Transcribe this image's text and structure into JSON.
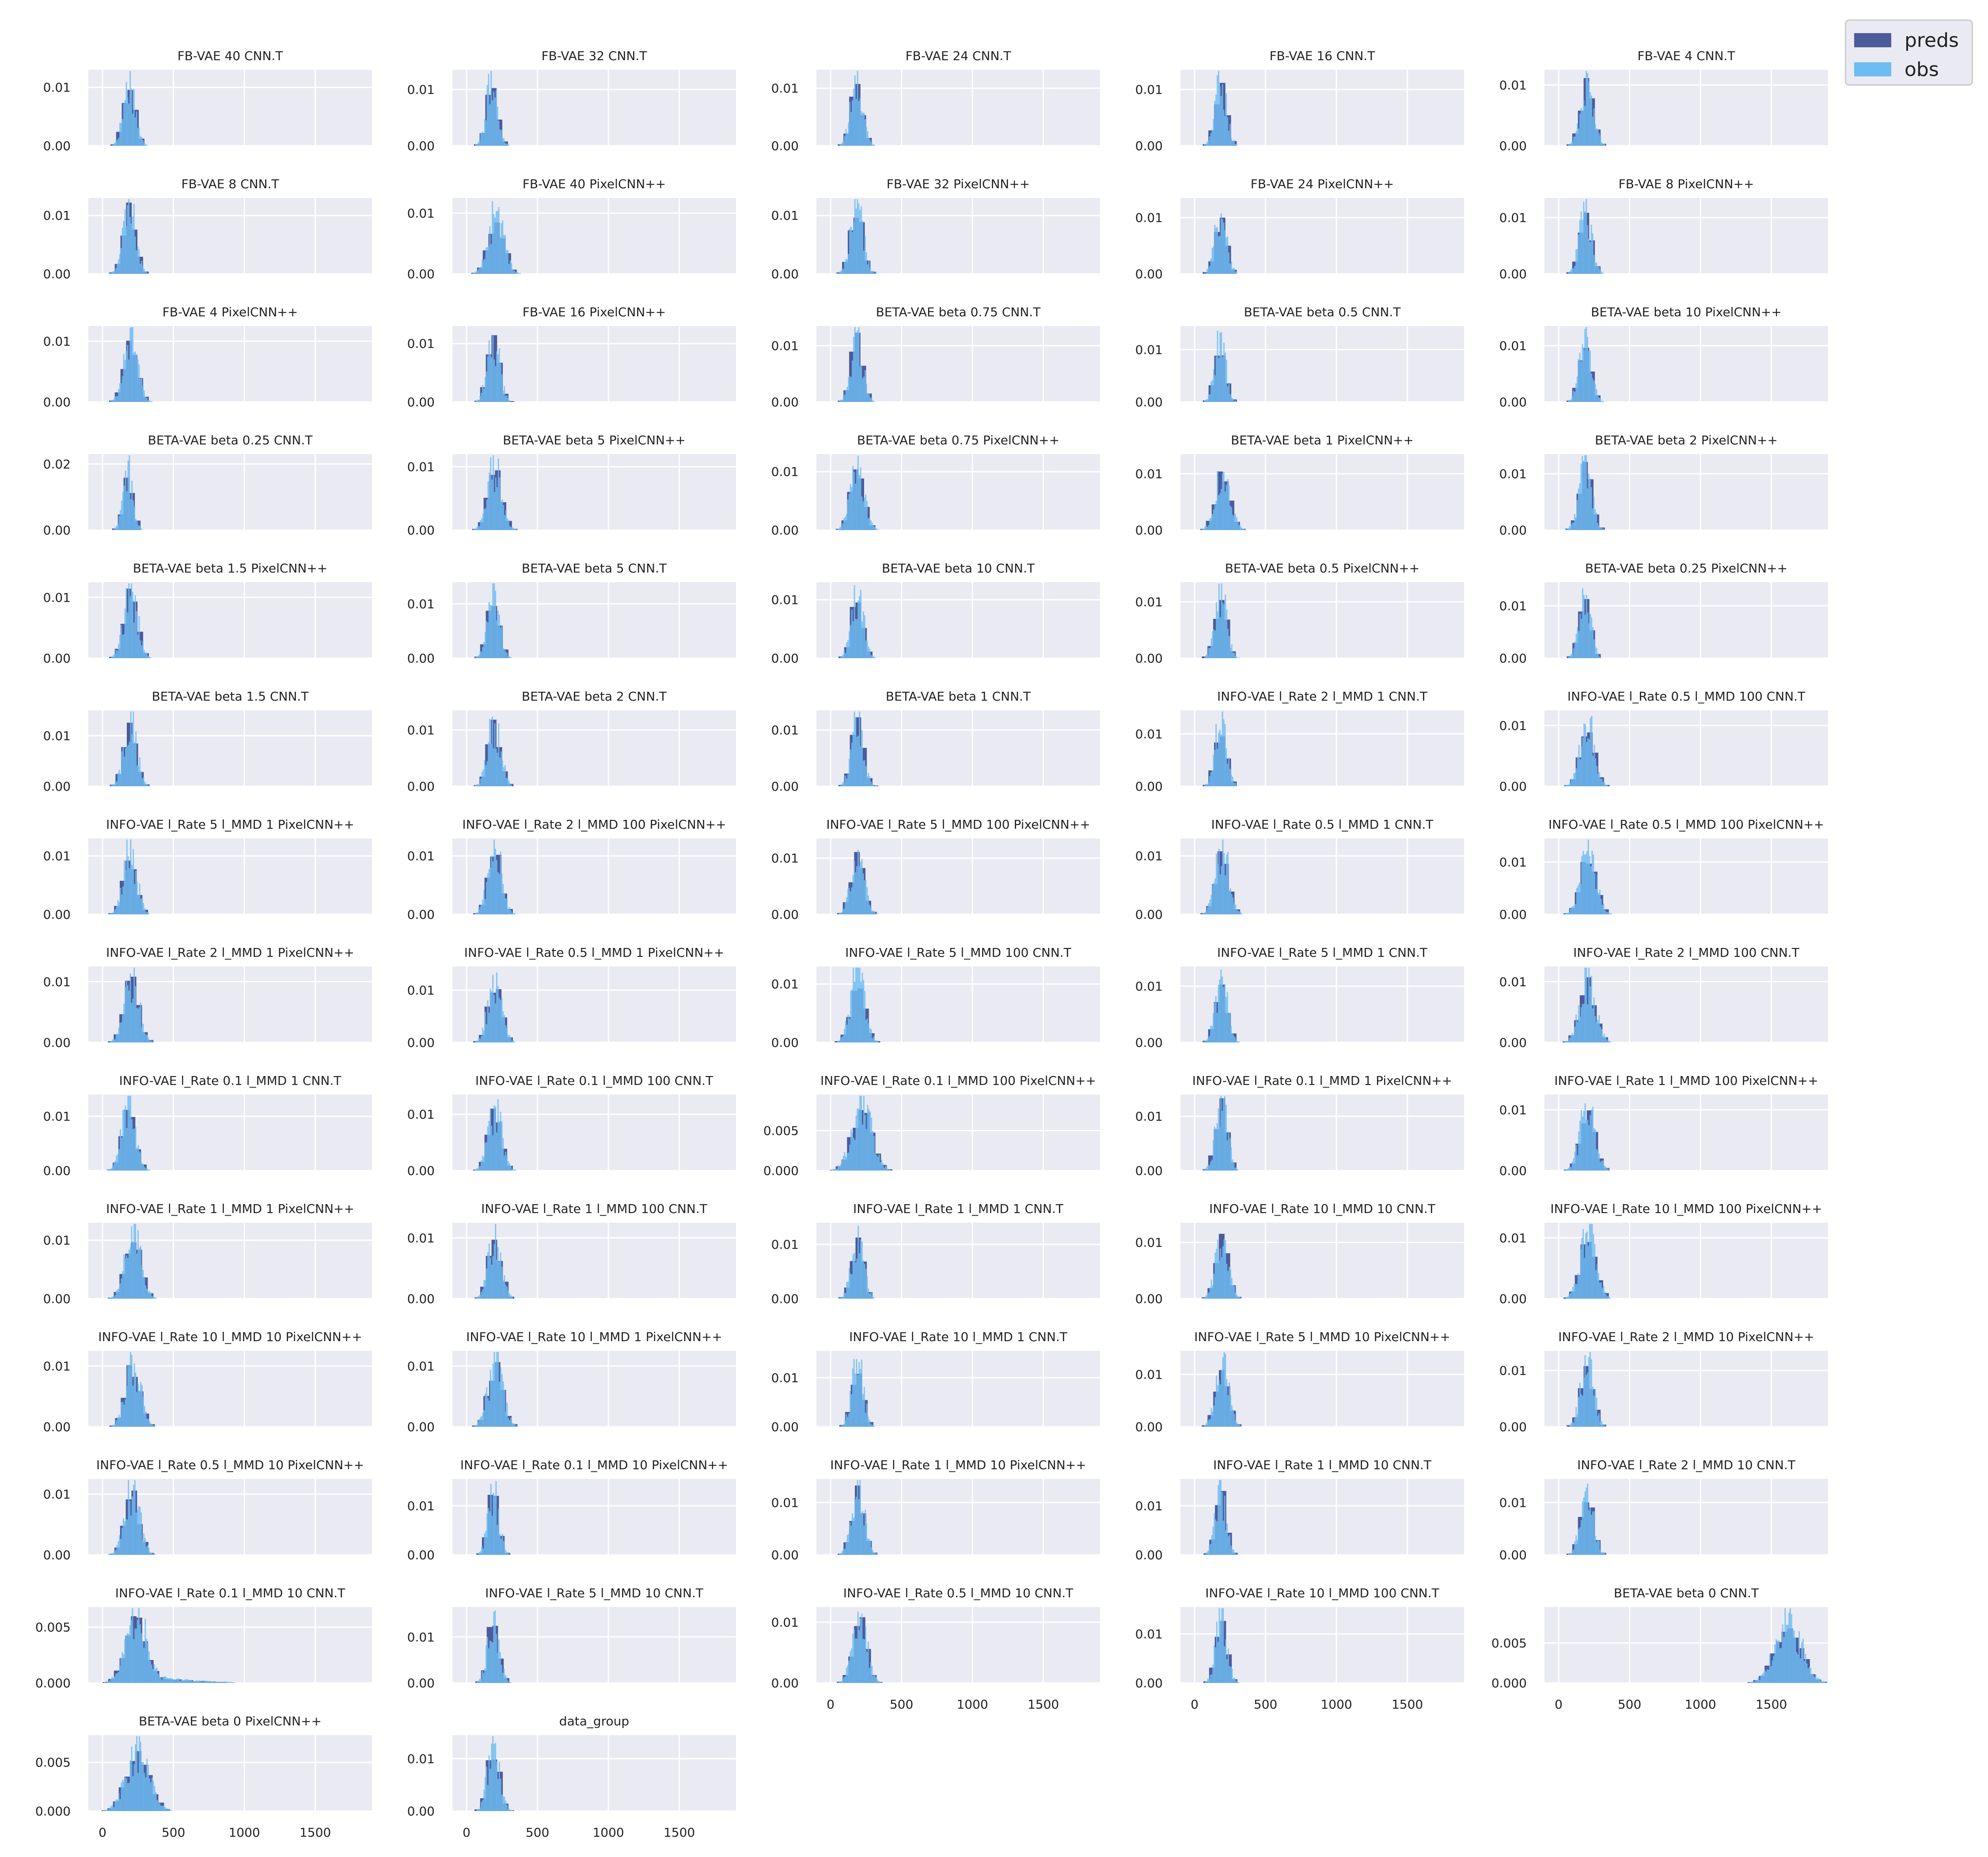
{
  "colors": {
    "preds": "#4c5b9b",
    "obs": "#6ebcf2",
    "overlap": "#4fa1de",
    "panel_bg": "#eaeaf2",
    "grid": "#ffffff",
    "text": "#222222"
  },
  "legend": {
    "placement": "top-right",
    "items": [
      {
        "label": "preds",
        "color": "#4c5b9b"
      },
      {
        "label": "obs",
        "color": "#6ebcf2"
      }
    ]
  },
  "chart_data": {
    "type": "histogram_grid",
    "xlim": [
      -100,
      1900
    ],
    "x_ticks": [
      0,
      500,
      1000,
      1500
    ],
    "x_tick_labels": [
      "0",
      "500",
      "1000",
      "1500"
    ],
    "grid": true,
    "series_names": [
      "preds",
      "obs"
    ],
    "panels": [
      {
        "title": "FB-VAE 40 CNN.T",
        "yticks": [
          0,
          0.01
        ],
        "ytick_labels": [
          "0.00",
          "0.01"
        ],
        "ymax": 0.013,
        "mean": 190,
        "sd": 42,
        "peak": 0.0115
      },
      {
        "title": "FB-VAE 32 CNN.T",
        "yticks": [
          0,
          0.01
        ],
        "ytick_labels": [
          "0.00",
          "0.01"
        ],
        "ymax": 0.0135,
        "mean": 180,
        "sd": 40,
        "peak": 0.0122
      },
      {
        "title": "FB-VAE 24 CNN.T",
        "yticks": [
          0,
          0.01
        ],
        "ytick_labels": [
          "0.00",
          "0.01"
        ],
        "ymax": 0.0132,
        "mean": 185,
        "sd": 42,
        "peak": 0.0118
      },
      {
        "title": "FB-VAE 16 CNN.T",
        "yticks": [
          0,
          0.01
        ],
        "ytick_labels": [
          "0.00",
          "0.01"
        ],
        "ymax": 0.0135,
        "mean": 185,
        "sd": 40,
        "peak": 0.0122
      },
      {
        "title": "FB-VAE 4 CNN.T",
        "yticks": [
          0,
          0.01
        ],
        "ytick_labels": [
          "0.00",
          "0.01"
        ],
        "ymax": 0.0125,
        "mean": 200,
        "sd": 45,
        "peak": 0.0112
      },
      {
        "title": "FB-VAE 8 CNN.T",
        "yticks": [
          0,
          0.01
        ],
        "ytick_labels": [
          "0.00",
          "0.01"
        ],
        "ymax": 0.013,
        "mean": 190,
        "sd": 45,
        "peak": 0.0118
      },
      {
        "title": "FB-VAE 40 PixelCNN++",
        "yticks": [
          0,
          0.01
        ],
        "ytick_labels": [
          "0.00",
          "0.01"
        ],
        "ymax": 0.0125,
        "mean": 210,
        "sd": 55,
        "peak": 0.0105
      },
      {
        "title": "FB-VAE 32 PixelCNN++",
        "yticks": [
          0,
          0.01
        ],
        "ytick_labels": [
          "0.00",
          "0.01"
        ],
        "ymax": 0.013,
        "mean": 185,
        "sd": 45,
        "peak": 0.0118
      },
      {
        "title": "FB-VAE 24 PixelCNN++",
        "yticks": [
          0,
          0.01
        ],
        "ytick_labels": [
          "0.00",
          "0.01"
        ],
        "ymax": 0.0135,
        "mean": 185,
        "sd": 40,
        "peak": 0.0122
      },
      {
        "title": "FB-VAE 8 PixelCNN++",
        "yticks": [
          0,
          0.01
        ],
        "ytick_labels": [
          "0.00",
          "0.01"
        ],
        "ymax": 0.0135,
        "mean": 190,
        "sd": 42,
        "peak": 0.0122
      },
      {
        "title": "FB-VAE 4 PixelCNN++",
        "yticks": [
          0,
          0.01
        ],
        "ytick_labels": [
          "0.00",
          "0.01"
        ],
        "ymax": 0.0125,
        "mean": 200,
        "sd": 48,
        "peak": 0.0112
      },
      {
        "title": "FB-VAE 16 PixelCNN++",
        "yticks": [
          0,
          0.01
        ],
        "ytick_labels": [
          "0.00",
          "0.01"
        ],
        "ymax": 0.013,
        "mean": 190,
        "sd": 42,
        "peak": 0.0118
      },
      {
        "title": "BETA-VAE beta 0.75 CNN.T",
        "yticks": [
          0,
          0.01
        ],
        "ytick_labels": [
          "0.00",
          "0.01"
        ],
        "ymax": 0.0135,
        "mean": 185,
        "sd": 42,
        "peak": 0.0122
      },
      {
        "title": "BETA-VAE beta 0.5 CNN.T",
        "yticks": [
          0,
          0.01
        ],
        "ytick_labels": [
          "0.00",
          "0.01"
        ],
        "ymax": 0.0145,
        "mean": 180,
        "sd": 38,
        "peak": 0.0132
      },
      {
        "title": "BETA-VAE beta 10 PixelCNN++",
        "yticks": [
          0,
          0.01
        ],
        "ytick_labels": [
          "0.00",
          "0.01"
        ],
        "ymax": 0.0135,
        "mean": 190,
        "sd": 42,
        "peak": 0.0122
      },
      {
        "title": "BETA-VAE beta 0.25 CNN.T",
        "yticks": [
          0,
          0.02
        ],
        "ytick_labels": [
          "0.00",
          "0.02"
        ],
        "ymax": 0.023,
        "mean": 180,
        "sd": 35,
        "peak": 0.0185
      },
      {
        "title": "BETA-VAE beta 5 PixelCNN++",
        "yticks": [
          0,
          0.01
        ],
        "ytick_labels": [
          "0.00",
          "0.01"
        ],
        "ymax": 0.012,
        "mean": 200,
        "sd": 50,
        "peak": 0.0108
      },
      {
        "title": "BETA-VAE beta 0.75 PixelCNN++",
        "yticks": [
          0,
          0.01
        ],
        "ytick_labels": [
          "0.00",
          "0.01"
        ],
        "ymax": 0.013,
        "mean": 190,
        "sd": 48,
        "peak": 0.0118
      },
      {
        "title": "BETA-VAE beta 1 PixelCNN++",
        "yticks": [
          0,
          0.01
        ],
        "ytick_labels": [
          "0.00",
          "0.01"
        ],
        "ymax": 0.0135,
        "mean": 200,
        "sd": 50,
        "peak": 0.0118
      },
      {
        "title": "BETA-VAE beta 2 PixelCNN++",
        "yticks": [
          0,
          0.01
        ],
        "ytick_labels": [
          "0.00",
          "0.01"
        ],
        "ymax": 0.0135,
        "mean": 190,
        "sd": 45,
        "peak": 0.0122
      },
      {
        "title": "BETA-VAE beta 1.5 PixelCNN++",
        "yticks": [
          0,
          0.01
        ],
        "ytick_labels": [
          "0.00",
          "0.01"
        ],
        "ymax": 0.0125,
        "mean": 200,
        "sd": 48,
        "peak": 0.0115
      },
      {
        "title": "BETA-VAE beta 5 CNN.T",
        "yticks": [
          0,
          0.01
        ],
        "ytick_labels": [
          "0.00",
          "0.01"
        ],
        "ymax": 0.014,
        "mean": 190,
        "sd": 42,
        "peak": 0.0125
      },
      {
        "title": "BETA-VAE beta 10 CNN.T",
        "yticks": [
          0,
          0.01
        ],
        "ytick_labels": [
          "0.00",
          "0.01"
        ],
        "ymax": 0.013,
        "mean": 190,
        "sd": 42,
        "peak": 0.0118
      },
      {
        "title": "BETA-VAE beta 0.5 PixelCNN++",
        "yticks": [
          0,
          0.01
        ],
        "ytick_labels": [
          "0.00",
          "0.01"
        ],
        "ymax": 0.0135,
        "mean": 185,
        "sd": 42,
        "peak": 0.0122
      },
      {
        "title": "BETA-VAE beta 0.25 PixelCNN++",
        "yticks": [
          0,
          0.01
        ],
        "ytick_labels": [
          "0.00",
          "0.01"
        ],
        "ymax": 0.0145,
        "mean": 185,
        "sd": 40,
        "peak": 0.0132
      },
      {
        "title": "BETA-VAE beta 1.5 CNN.T",
        "yticks": [
          0,
          0.01
        ],
        "ytick_labels": [
          "0.00",
          "0.01"
        ],
        "ymax": 0.015,
        "mean": 195,
        "sd": 45,
        "peak": 0.0135
      },
      {
        "title": "BETA-VAE beta 2 CNN.T",
        "yticks": [
          0,
          0.01
        ],
        "ytick_labels": [
          "0.00",
          "0.01"
        ],
        "ymax": 0.0135,
        "mean": 195,
        "sd": 45,
        "peak": 0.0122
      },
      {
        "title": "BETA-VAE beta 1 CNN.T",
        "yticks": [
          0,
          0.01
        ],
        "ytick_labels": [
          "0.00",
          "0.01"
        ],
        "ymax": 0.0135,
        "mean": 190,
        "sd": 42,
        "peak": 0.0122
      },
      {
        "title": "INFO-VAE l_Rate 2 l_MMD 1 CNN.T",
        "yticks": [
          0,
          0.01
        ],
        "ytick_labels": [
          "0.00",
          "0.01"
        ],
        "ymax": 0.0145,
        "mean": 185,
        "sd": 40,
        "peak": 0.0132
      },
      {
        "title": "INFO-VAE l_Rate 0.5 l_MMD 100 CNN.T",
        "yticks": [
          0,
          0.01
        ],
        "ytick_labels": [
          "0.00",
          "0.01"
        ],
        "ymax": 0.0125,
        "mean": 200,
        "sd": 50,
        "peak": 0.0112
      },
      {
        "title": "INFO-VAE l_Rate 5 l_MMD 1 PixelCNN++",
        "yticks": [
          0,
          0.01
        ],
        "ytick_labels": [
          "0.00",
          "0.01"
        ],
        "ymax": 0.013,
        "mean": 195,
        "sd": 48,
        "peak": 0.0115
      },
      {
        "title": "INFO-VAE l_Rate 2 l_MMD 100 PixelCNN++",
        "yticks": [
          0,
          0.01
        ],
        "ytick_labels": [
          "0.00",
          "0.01"
        ],
        "ymax": 0.013,
        "mean": 200,
        "sd": 48,
        "peak": 0.0118
      },
      {
        "title": "INFO-VAE l_Rate 5 l_MMD 100 PixelCNN++",
        "yticks": [
          0,
          0.01
        ],
        "ytick_labels": [
          "0.00",
          "0.01"
        ],
        "ymax": 0.0135,
        "mean": 190,
        "sd": 45,
        "peak": 0.0122
      },
      {
        "title": "INFO-VAE l_Rate 0.5 l_MMD 1 CNN.T",
        "yticks": [
          0,
          0.01
        ],
        "ytick_labels": [
          "0.00",
          "0.01"
        ],
        "ymax": 0.013,
        "mean": 195,
        "sd": 48,
        "peak": 0.0118
      },
      {
        "title": "INFO-VAE l_Rate 0.5 l_MMD 100 PixelCNN++",
        "yticks": [
          0,
          0.01
        ],
        "ytick_labels": [
          "0.00",
          "0.01"
        ],
        "ymax": 0.0145,
        "mean": 210,
        "sd": 55,
        "peak": 0.0125
      },
      {
        "title": "INFO-VAE l_Rate 2 l_MMD 1 PixelCNN++",
        "yticks": [
          0,
          0.01
        ],
        "ytick_labels": [
          "0.00",
          "0.01"
        ],
        "ymax": 0.0125,
        "mean": 205,
        "sd": 52,
        "peak": 0.0112
      },
      {
        "title": "INFO-VAE l_Rate 0.5 l_MMD 1 PixelCNN++",
        "yticks": [
          0,
          0.01
        ],
        "ytick_labels": [
          "0.00",
          "0.01"
        ],
        "ymax": 0.0145,
        "mean": 200,
        "sd": 48,
        "peak": 0.0128
      },
      {
        "title": "INFO-VAE l_Rate 5 l_MMD 100 CNN.T",
        "yticks": [
          0,
          0.01
        ],
        "ytick_labels": [
          "0.00",
          "0.01"
        ],
        "ymax": 0.013,
        "mean": 190,
        "sd": 50,
        "peak": 0.0118
      },
      {
        "title": "INFO-VAE l_Rate 5 l_MMD 1 CNN.T",
        "yticks": [
          0,
          0.01
        ],
        "ytick_labels": [
          "0.00",
          "0.01"
        ],
        "ymax": 0.0135,
        "mean": 190,
        "sd": 42,
        "peak": 0.0122
      },
      {
        "title": "INFO-VAE l_Rate 2 l_MMD 100 CNN.T",
        "yticks": [
          0,
          0.01
        ],
        "ytick_labels": [
          "0.00",
          "0.01"
        ],
        "ymax": 0.0125,
        "mean": 205,
        "sd": 55,
        "peak": 0.0108
      },
      {
        "title": "INFO-VAE l_Rate 0.1 l_MMD 1 CNN.T",
        "yticks": [
          0,
          0.01
        ],
        "ytick_labels": [
          "0.00",
          "0.01"
        ],
        "ymax": 0.014,
        "mean": 185,
        "sd": 48,
        "peak": 0.0125
      },
      {
        "title": "INFO-VAE l_Rate 0.1 l_MMD 100 CNN.T",
        "yticks": [
          0,
          0.01
        ],
        "ytick_labels": [
          "0.00",
          "0.01"
        ],
        "ymax": 0.0135,
        "mean": 200,
        "sd": 48,
        "peak": 0.0118
      },
      {
        "title": "INFO-VAE l_Rate 0.1 l_MMD 100 PixelCNN++",
        "yticks": [
          0,
          0.005
        ],
        "ytick_labels": [
          "0.000",
          "0.005"
        ],
        "ymax": 0.0095,
        "mean": 220,
        "sd": 70,
        "peak": 0.0085
      },
      {
        "title": "INFO-VAE l_Rate 0.1 l_MMD 1 PixelCNN++",
        "yticks": [
          0,
          0.01
        ],
        "ytick_labels": [
          "0.00",
          "0.01"
        ],
        "ymax": 0.014,
        "mean": 190,
        "sd": 42,
        "peak": 0.0128
      },
      {
        "title": "INFO-VAE l_Rate 1 l_MMD 100 PixelCNN++",
        "yticks": [
          0,
          0.01
        ],
        "ytick_labels": [
          "0.00",
          "0.01"
        ],
        "ymax": 0.0125,
        "mean": 205,
        "sd": 52,
        "peak": 0.0112
      },
      {
        "title": "INFO-VAE l_Rate 1 l_MMD 1 PixelCNN++",
        "yticks": [
          0,
          0.01
        ],
        "ytick_labels": [
          "0.00",
          "0.01"
        ],
        "ymax": 0.013,
        "mean": 215,
        "sd": 55,
        "peak": 0.0115
      },
      {
        "title": "INFO-VAE l_Rate 1 l_MMD 100 CNN.T",
        "yticks": [
          0,
          0.01
        ],
        "ytick_labels": [
          "0.00",
          "0.01"
        ],
        "ymax": 0.0125,
        "mean": 200,
        "sd": 45,
        "peak": 0.0112
      },
      {
        "title": "INFO-VAE l_Rate 1 l_MMD 1 CNN.T",
        "yticks": [
          0,
          0.01
        ],
        "ytick_labels": [
          "0.00",
          "0.01"
        ],
        "ymax": 0.014,
        "mean": 190,
        "sd": 42,
        "peak": 0.0125
      },
      {
        "title": "INFO-VAE l_Rate 10 l_MMD 10 CNN.T",
        "yticks": [
          0,
          0.01
        ],
        "ytick_labels": [
          "0.00",
          "0.01"
        ],
        "ymax": 0.0135,
        "mean": 195,
        "sd": 45,
        "peak": 0.0122
      },
      {
        "title": "INFO-VAE l_Rate 10 l_MMD 100 PixelCNN++",
        "yticks": [
          0,
          0.01
        ],
        "ytick_labels": [
          "0.00",
          "0.01"
        ],
        "ymax": 0.0125,
        "mean": 210,
        "sd": 55,
        "peak": 0.0112
      },
      {
        "title": "INFO-VAE l_Rate 10 l_MMD 10 PixelCNN++",
        "yticks": [
          0,
          0.01
        ],
        "ytick_labels": [
          "0.00",
          "0.01"
        ],
        "ymax": 0.0125,
        "mean": 215,
        "sd": 52,
        "peak": 0.0112
      },
      {
        "title": "INFO-VAE l_Rate 10 l_MMD 1 PixelCNN++",
        "yticks": [
          0,
          0.01
        ],
        "ytick_labels": [
          "0.00",
          "0.01"
        ],
        "ymax": 0.0125,
        "mean": 205,
        "sd": 52,
        "peak": 0.0112
      },
      {
        "title": "INFO-VAE l_Rate 10 l_MMD 1 CNN.T",
        "yticks": [
          0,
          0.01
        ],
        "ytick_labels": [
          "0.00",
          "0.01"
        ],
        "ymax": 0.0155,
        "mean": 190,
        "sd": 40,
        "peak": 0.014
      },
      {
        "title": "INFO-VAE l_Rate 5 l_MMD 10 PixelCNN++",
        "yticks": [
          0,
          0.01
        ],
        "ytick_labels": [
          "0.00",
          "0.01"
        ],
        "ymax": 0.0145,
        "mean": 195,
        "sd": 45,
        "peak": 0.0128
      },
      {
        "title": "INFO-VAE l_Rate 2 l_MMD 10 PixelCNN++",
        "yticks": [
          0,
          0.01
        ],
        "ytick_labels": [
          "0.00",
          "0.01"
        ],
        "ymax": 0.0135,
        "mean": 200,
        "sd": 45,
        "peak": 0.0122
      },
      {
        "title": "INFO-VAE l_Rate 0.5 l_MMD 10 PixelCNN++",
        "yticks": [
          0,
          0.01
        ],
        "ytick_labels": [
          "0.00",
          "0.01"
        ],
        "ymax": 0.0125,
        "mean": 210,
        "sd": 52,
        "peak": 0.0112
      },
      {
        "title": "INFO-VAE l_Rate 0.1 l_MMD 10 PixelCNN++",
        "yticks": [
          0,
          0.01
        ],
        "ytick_labels": [
          "0.00",
          "0.01"
        ],
        "ymax": 0.0155,
        "mean": 190,
        "sd": 38,
        "peak": 0.014
      },
      {
        "title": "INFO-VAE l_Rate 1 l_MMD 10 PixelCNN++",
        "yticks": [
          0,
          0.01
        ],
        "ytick_labels": [
          "0.00",
          "0.01"
        ],
        "ymax": 0.0145,
        "mean": 195,
        "sd": 45,
        "peak": 0.0132
      },
      {
        "title": "INFO-VAE l_Rate 1 l_MMD 10 CNN.T",
        "yticks": [
          0,
          0.01
        ],
        "ytick_labels": [
          "0.00",
          "0.01"
        ],
        "ymax": 0.0155,
        "mean": 185,
        "sd": 38,
        "peak": 0.014
      },
      {
        "title": "INFO-VAE l_Rate 2 l_MMD 10 CNN.T",
        "yticks": [
          0,
          0.01
        ],
        "ytick_labels": [
          "0.00",
          "0.01"
        ],
        "ymax": 0.0145,
        "mean": 200,
        "sd": 45,
        "peak": 0.0128
      },
      {
        "title": "INFO-VAE l_Rate 0.1 l_MMD 10 CNN.T",
        "yticks": [
          0,
          0.005
        ],
        "ytick_labels": [
          "0.000",
          "0.005"
        ],
        "ymax": 0.0068,
        "mean": 240,
        "sd": 75,
        "peak": 0.0065,
        "tail": 700
      },
      {
        "title": "INFO-VAE l_Rate 5 l_MMD 10 CNN.T",
        "yticks": [
          0,
          0.01
        ],
        "ytick_labels": [
          "0.00",
          "0.01"
        ],
        "ymax": 0.0165,
        "mean": 190,
        "sd": 40,
        "peak": 0.015
      },
      {
        "title": "INFO-VAE l_Rate 0.5 l_MMD 10 CNN.T",
        "yticks": [
          0,
          0.01
        ],
        "ytick_labels": [
          "0.00",
          "0.01"
        ],
        "ymax": 0.0125,
        "mean": 205,
        "sd": 50,
        "peak": 0.0112
      },
      {
        "title": "INFO-VAE l_Rate 10 l_MMD 100 CNN.T",
        "yticks": [
          0,
          0.01
        ],
        "ytick_labels": [
          "0.00",
          "0.01"
        ],
        "ymax": 0.0155,
        "mean": 190,
        "sd": 40,
        "peak": 0.014
      },
      {
        "title": "BETA-VAE beta 0 CNN.T",
        "yticks": [
          0,
          0.005
        ],
        "ytick_labels": [
          "0.000",
          "0.005"
        ],
        "ymax": 0.0095,
        "mean": 1620,
        "sd": 90,
        "peak": 0.0085
      },
      {
        "title": "BETA-VAE beta 0 PixelCNN++",
        "yticks": [
          0,
          0.005
        ],
        "ytick_labels": [
          "0.000",
          "0.005"
        ],
        "ymax": 0.0078,
        "mean": 250,
        "sd": 80,
        "peak": 0.0068
      },
      {
        "title": "data_group",
        "yticks": [
          0,
          0.01
        ],
        "ytick_labels": [
          "0.00",
          "0.01"
        ],
        "ymax": 0.0145,
        "mean": 190,
        "sd": 42,
        "peak": 0.013
      }
    ]
  }
}
